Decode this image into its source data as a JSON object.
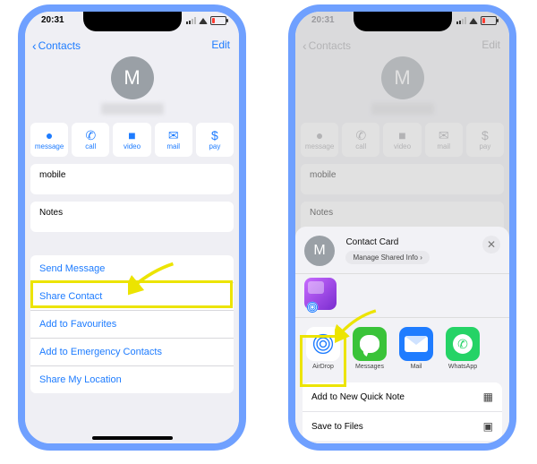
{
  "status": {
    "time": "20:31"
  },
  "nav": {
    "back": "Contacts",
    "edit": "Edit"
  },
  "avatar_letter": "M",
  "actions": {
    "message": "message",
    "call": "call",
    "video": "video",
    "mail": "mail",
    "pay": "pay"
  },
  "section": {
    "mobile": "mobile",
    "notes": "Notes"
  },
  "options": {
    "send_message": "Send Message",
    "share_contact": "Share Contact",
    "add_favourites": "Add to Favourites",
    "add_emergency": "Add to Emergency Contacts",
    "share_location": "Share My Location"
  },
  "share_sheet": {
    "title": "Contact Card",
    "manage": "Manage Shared Info",
    "apps": {
      "airdrop": "AirDrop",
      "messages": "Messages",
      "mail": "Mail",
      "whatsapp": "WhatsApp"
    },
    "quick_note": "Add to New Quick Note",
    "save_files": "Save to Files"
  },
  "glyph": {
    "message": "●",
    "call": "✆",
    "video": "■",
    "mail": "✉",
    "pay": "$",
    "close": "✕",
    "chevron": "›",
    "note": "▦",
    "folder": "▣"
  }
}
